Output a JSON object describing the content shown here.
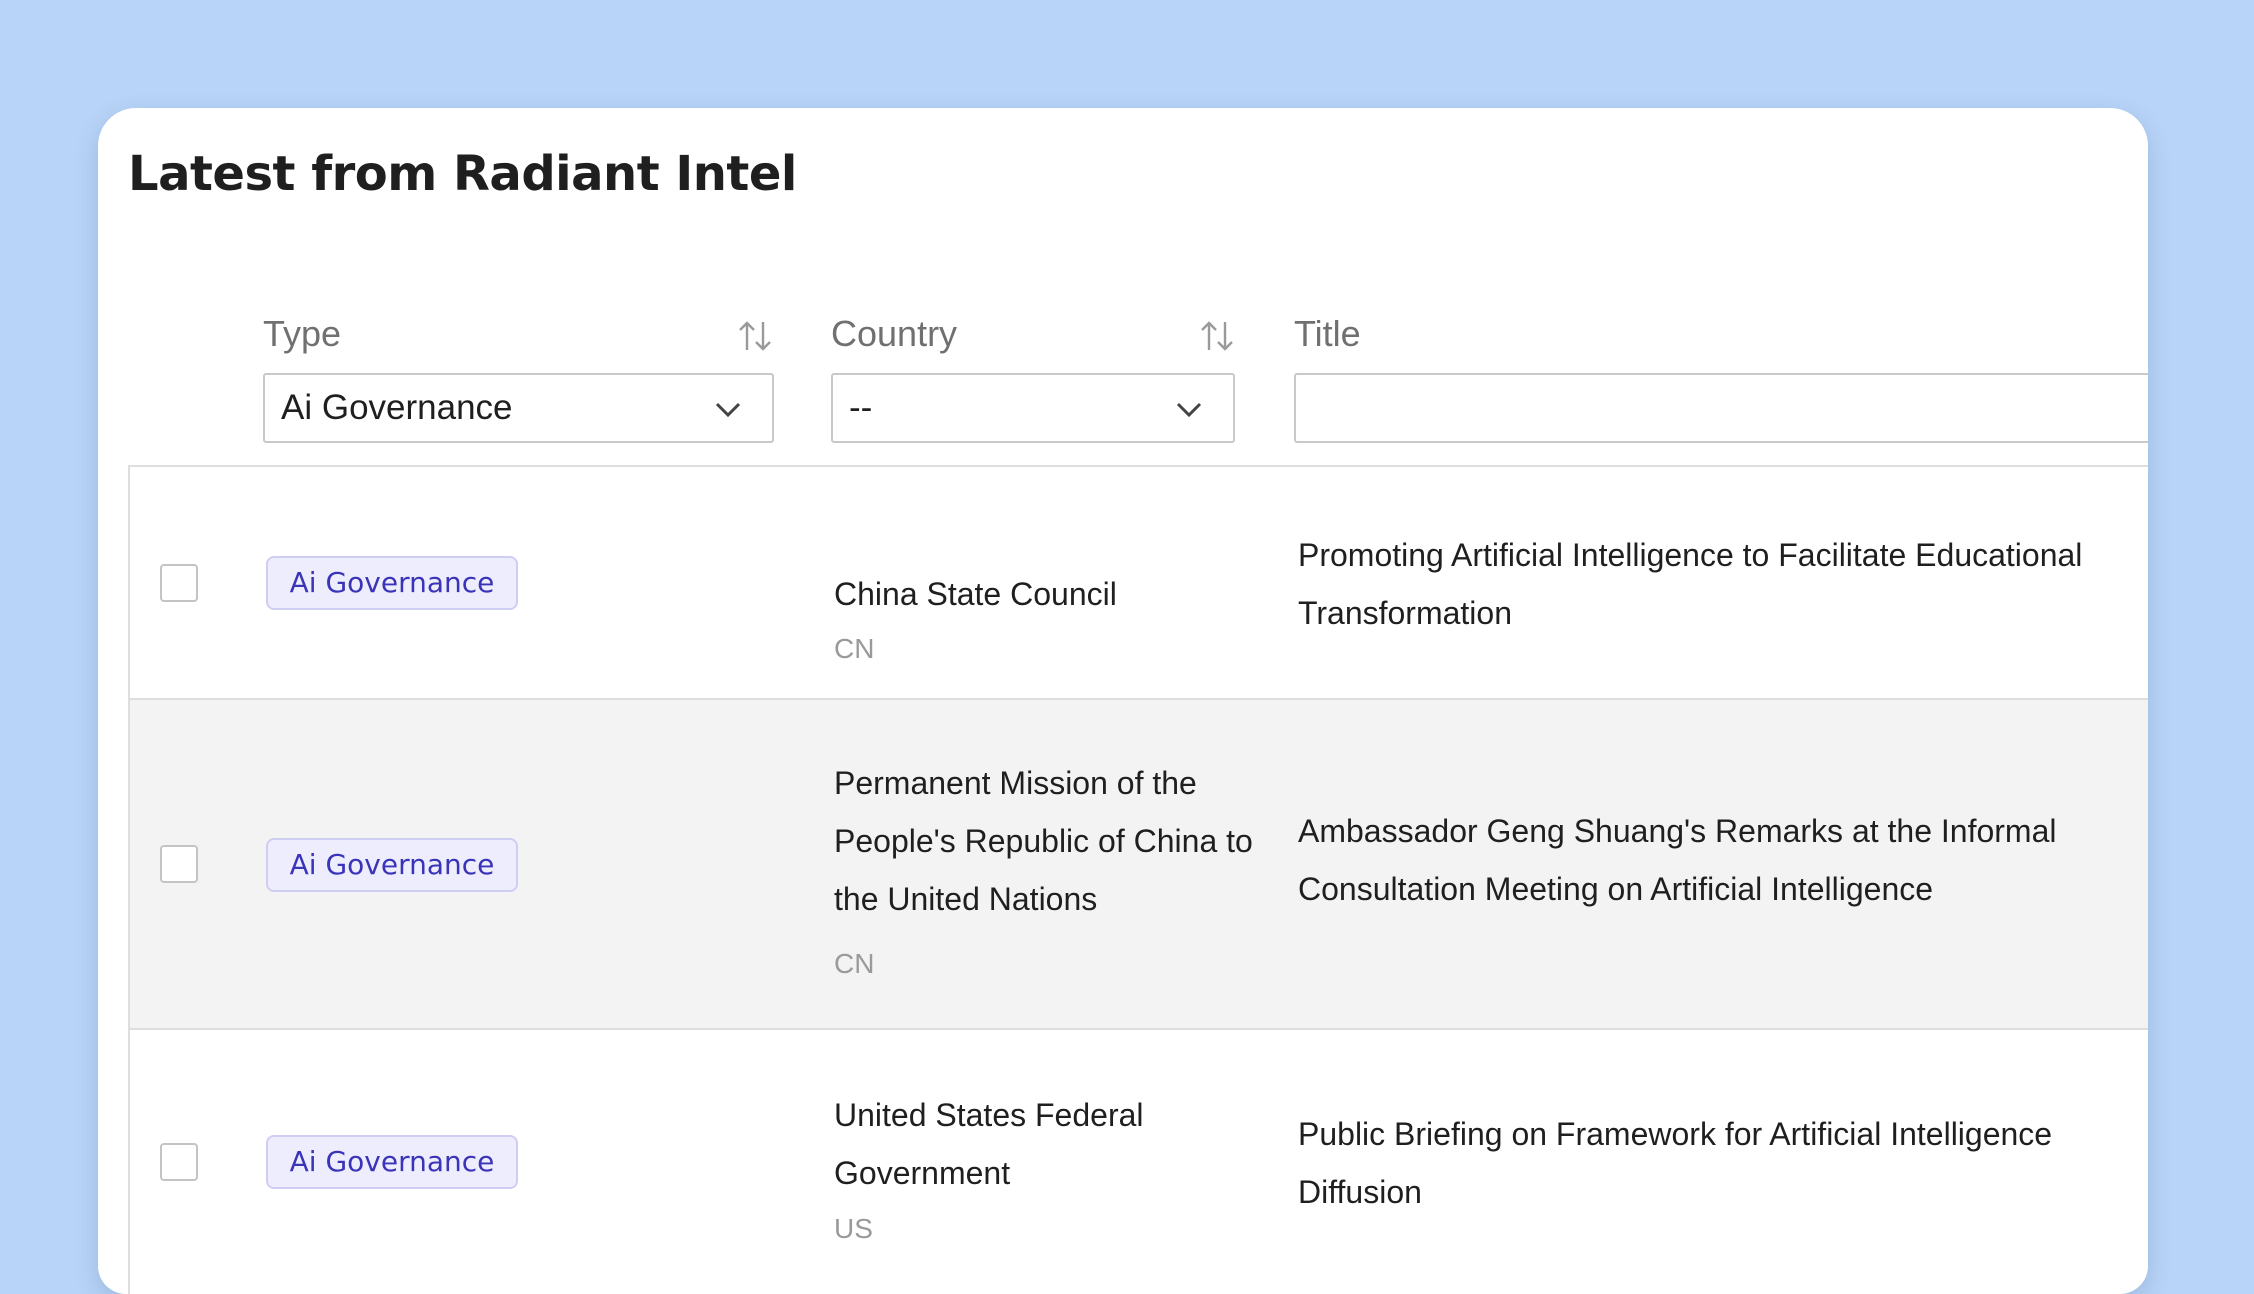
{
  "page": {
    "title": "Latest from Radiant Intel"
  },
  "columns": {
    "type": {
      "label": "Type",
      "filter_value": "Ai Governance"
    },
    "country": {
      "label": "Country",
      "filter_value": "--"
    },
    "title": {
      "label": "Title",
      "filter_value": ""
    }
  },
  "rows": [
    {
      "type": "Ai Governance",
      "organization": "China State Council",
      "country_code": "CN",
      "title": "Promoting Artificial Intelligence to Facilitate Educational Transformation"
    },
    {
      "type": "Ai Governance",
      "organization": "Permanent Mission of the People's Republic of China to the United Nations",
      "country_code": "CN",
      "title": "Ambassador Geng Shuang's Remarks at the Informal Consultation Meeting on Artificial Intelligence"
    },
    {
      "type": "Ai Governance",
      "organization": "United States Federal Government",
      "country_code": "US",
      "title": "Public Briefing on Framework for Artificial Intelligence Diffusion"
    }
  ],
  "icons": {
    "sort": "sort-arrows-icon",
    "dropdown": "chevron-down-icon"
  },
  "colors": {
    "background": "#b8d4f8",
    "badge_text": "#3a34b8",
    "badge_bg": "#eeedfd"
  }
}
